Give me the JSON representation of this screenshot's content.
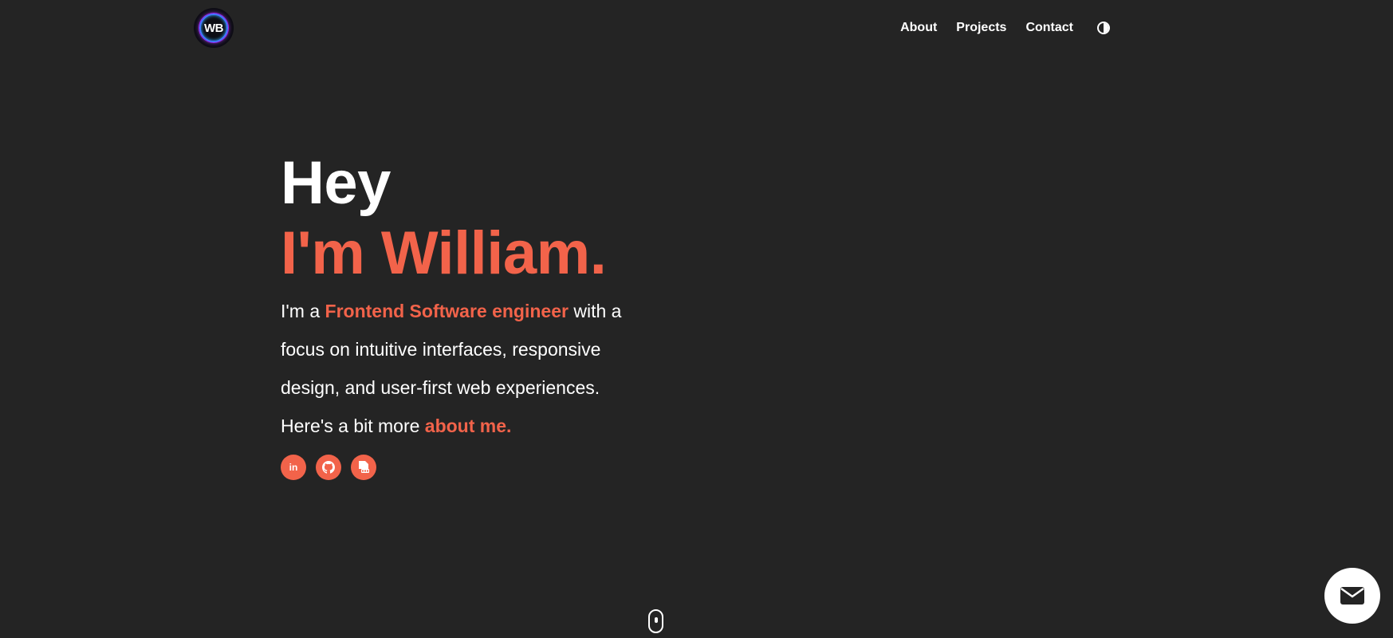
{
  "header": {
    "logo_text": "WB",
    "nav": [
      {
        "label": "About"
      },
      {
        "label": "Projects"
      },
      {
        "label": "Contact"
      }
    ],
    "theme_toggle_icon": "contrast-icon"
  },
  "hero": {
    "greeting": "Hey",
    "name": "I'm William.",
    "desc_prefix": "I'm a ",
    "desc_role": "Frontend Software engineer",
    "desc_body": " with a focus on intuitive interfaces, responsive design, and user-first web experiences. Here's a bit more ",
    "desc_link": "about me.",
    "socials": [
      {
        "icon": "linkedin-icon",
        "glyph": "in"
      },
      {
        "icon": "github-icon",
        "glyph": ""
      },
      {
        "icon": "pdf-resume-icon",
        "glyph": ""
      }
    ]
  },
  "colors": {
    "background": "#242424",
    "accent": "#f2634a",
    "text": "#ffffff"
  },
  "scroll_icon": "mouse-scroll-icon",
  "mail_icon": "mail-icon"
}
